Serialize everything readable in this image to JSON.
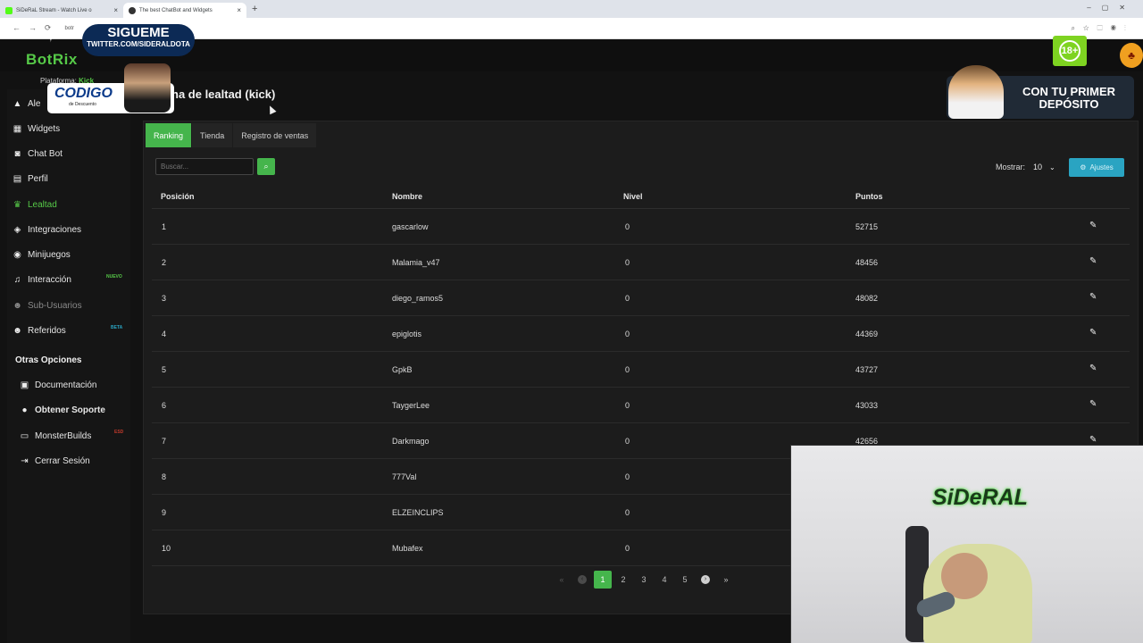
{
  "browser": {
    "tabs": [
      {
        "title": "SiDeRaL Stream - Watch Live o",
        "close": "×"
      },
      {
        "title": "The best ChatBot and Widgets",
        "close": "×"
      }
    ],
    "new_tab": "+",
    "url": "botr"
  },
  "overlays": {
    "sigueme": "SIGUEME",
    "twitter": "TWITTER.COM/SIDERALDOTA",
    "codigo": "CODIGO",
    "codigo_sub": "de Descuento",
    "ad_text": "CON TU PRIMER DEPÓSITO",
    "age": "18+",
    "webcam_logo": "SiDeRAL"
  },
  "brand": "BotRix",
  "platform_label": "Plataforma:",
  "platform_value": "Kick",
  "page_title": "na de lealtad (kick)",
  "sidebar": {
    "items": [
      {
        "label": "Ale",
        "icon": "warning-icon"
      },
      {
        "label": "Widgets",
        "icon": "grid-icon"
      },
      {
        "label": "Chat Bot",
        "icon": "robot-icon"
      },
      {
        "label": "Perfil",
        "icon": "id-card-icon"
      },
      {
        "label": "Lealtad",
        "icon": "trophy-icon"
      },
      {
        "label": "Integraciones",
        "icon": "cube-icon"
      },
      {
        "label": "Minijuegos",
        "icon": "gamepad-icon"
      },
      {
        "label": "Interacción",
        "icon": "music-icon"
      },
      {
        "label": "Sub-Usuarios",
        "icon": "users-icon"
      },
      {
        "label": "Referidos",
        "icon": "user-group-icon"
      }
    ],
    "badges": {
      "nuevo": "NUEVO",
      "beta": "BETA",
      "red": "ESD"
    },
    "section_title": "Otras Opciones",
    "other": [
      {
        "label": "Documentación",
        "icon": "book-icon"
      },
      {
        "label": "Obtener Soporte",
        "icon": "help-icon"
      },
      {
        "label": "MonsterBuilds",
        "icon": "laptop-icon"
      },
      {
        "label": "Cerrar Sesión",
        "icon": "logout-icon"
      }
    ]
  },
  "tabs": [
    "Ranking",
    "Tienda",
    "Registro de ventas"
  ],
  "search": {
    "placeholder": "Buscar..."
  },
  "mostrar_label": "Mostrar:",
  "mostrar_value": "10",
  "ajustes_label": "Ajustes",
  "table": {
    "headers": [
      "Posición",
      "Nombre",
      "Nivel",
      "Puntos"
    ],
    "rows": [
      {
        "pos": "1",
        "name": "gascarlow",
        "level": "0",
        "points": "52715"
      },
      {
        "pos": "2",
        "name": "Malamia_v47",
        "level": "0",
        "points": "48456"
      },
      {
        "pos": "3",
        "name": "diego_ramos5",
        "level": "0",
        "points": "48082"
      },
      {
        "pos": "4",
        "name": "epiglotis",
        "level": "0",
        "points": "44369"
      },
      {
        "pos": "5",
        "name": "GpkB",
        "level": "0",
        "points": "43727"
      },
      {
        "pos": "6",
        "name": "TaygerLee",
        "level": "0",
        "points": "43033"
      },
      {
        "pos": "7",
        "name": "Darkmago",
        "level": "0",
        "points": "42656"
      },
      {
        "pos": "8",
        "name": "777Val",
        "level": "0",
        "points": ""
      },
      {
        "pos": "9",
        "name": "ELZEINCLIPS",
        "level": "0",
        "points": ""
      },
      {
        "pos": "10",
        "name": "Mubafex",
        "level": "0",
        "points": ""
      }
    ]
  },
  "pagination": {
    "first": "«",
    "prev": "‹",
    "pages": [
      "1",
      "2",
      "3",
      "4",
      "5"
    ],
    "next": "›",
    "last": "»"
  },
  "colors": {
    "accent": "#45b54c",
    "button_info": "#2aa4c2",
    "background": "#121212"
  }
}
